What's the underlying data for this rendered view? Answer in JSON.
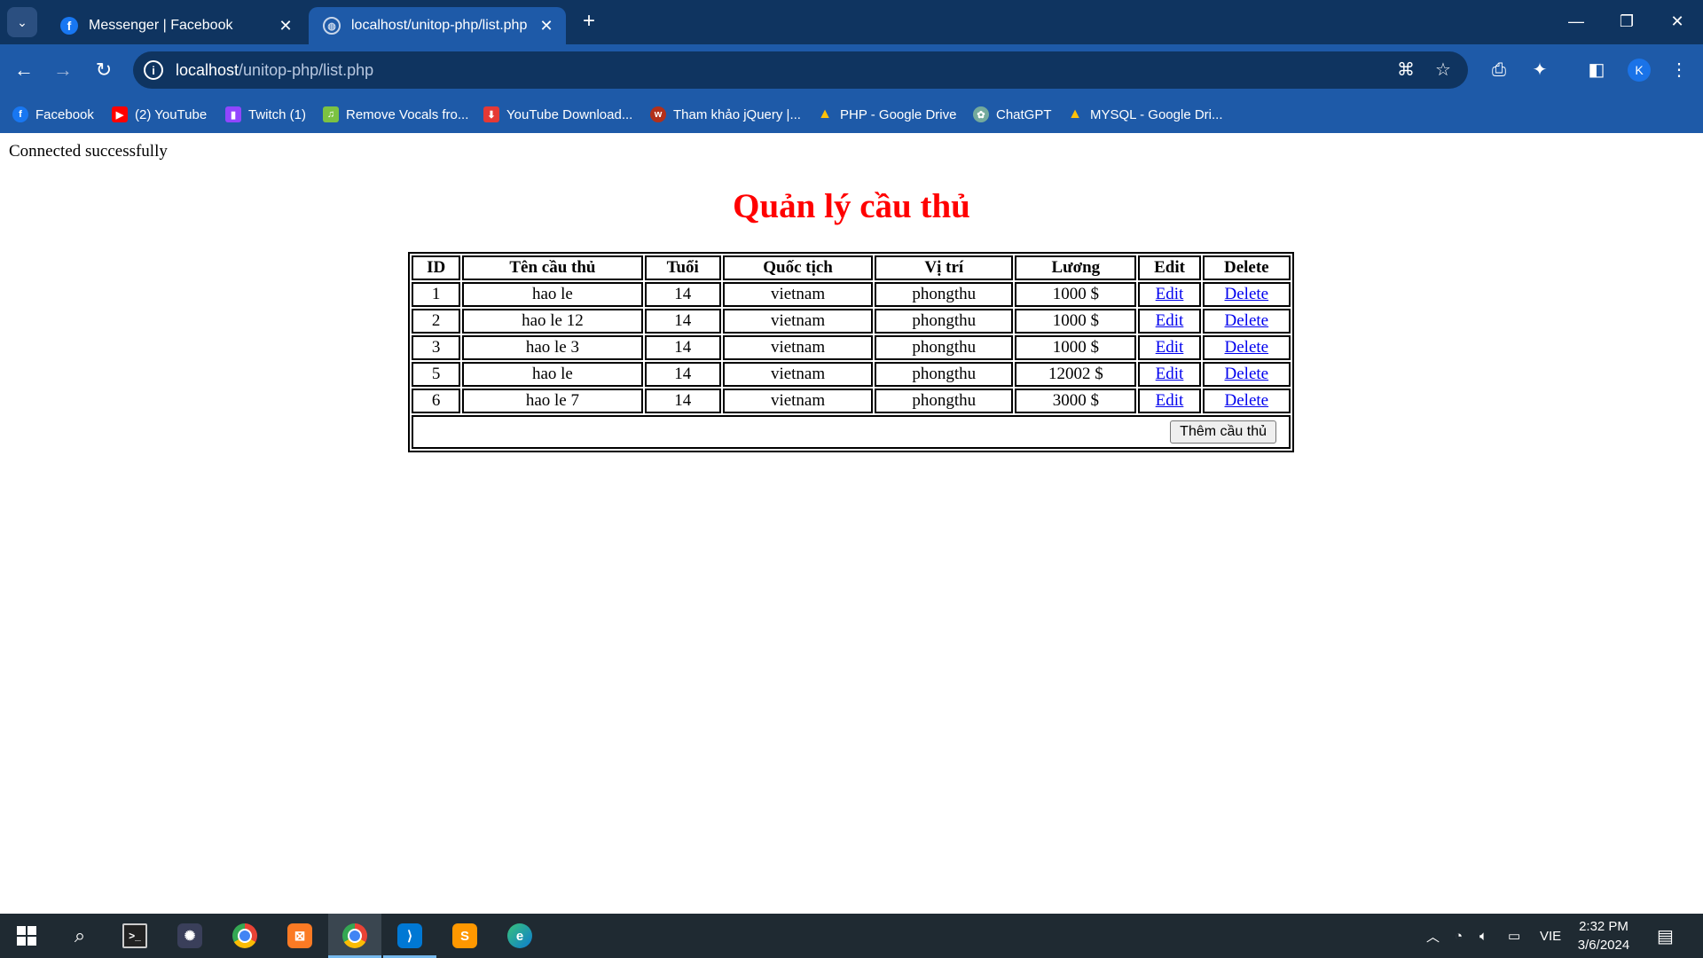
{
  "browser": {
    "tabs": [
      {
        "title": "Messenger | Facebook",
        "icon": "facebook-icon"
      },
      {
        "title": "localhost/unitop-php/list.php",
        "icon": "globe-icon",
        "active": true
      }
    ],
    "address": {
      "host": "localhost",
      "path": "/unitop-php/list.php"
    },
    "profile_initial": "K",
    "bookmarks": [
      {
        "label": "Facebook",
        "icon": "facebook-icon",
        "color": "#1877f2"
      },
      {
        "label": "(2) YouTube",
        "icon": "youtube-icon",
        "color": "#ff0000"
      },
      {
        "label": "Twitch (1)",
        "icon": "twitch-icon",
        "color": "#9146ff"
      },
      {
        "label": "Remove Vocals fro...",
        "icon": "music-icon",
        "color": "#7cc242"
      },
      {
        "label": "YouTube Download...",
        "icon": "download-icon",
        "color": "#e53935"
      },
      {
        "label": "Tham khảo jQuery |...",
        "icon": "w3schools-icon",
        "color": "#b2301a"
      },
      {
        "label": "PHP - Google Drive",
        "icon": "google-drive-icon",
        "color": "#1fa463"
      },
      {
        "label": "ChatGPT",
        "icon": "chatgpt-icon",
        "color": "#74aa9c"
      },
      {
        "label": "MYSQL - Google Dri...",
        "icon": "google-drive-icon",
        "color": "#1fa463"
      }
    ]
  },
  "page": {
    "status": "Connected successfully",
    "heading": "Quản lý cầu thủ",
    "heading_color": "#ff0000",
    "table": {
      "headers": [
        "ID",
        "Tên cầu thủ",
        "Tuổi",
        "Quốc tịch",
        "Vị trí",
        "Lương",
        "Edit",
        "Delete"
      ],
      "rows": [
        {
          "id": "1",
          "name": "hao le",
          "age": "14",
          "nationality": "vietnam",
          "position": "phongthu",
          "salary": "1000 $",
          "edit": "Edit",
          "delete": "Delete"
        },
        {
          "id": "2",
          "name": "hao le 12",
          "age": "14",
          "nationality": "vietnam",
          "position": "phongthu",
          "salary": "1000 $",
          "edit": "Edit",
          "delete": "Delete"
        },
        {
          "id": "3",
          "name": "hao le 3",
          "age": "14",
          "nationality": "vietnam",
          "position": "phongthu",
          "salary": "1000 $",
          "edit": "Edit",
          "delete": "Delete"
        },
        {
          "id": "5",
          "name": "hao le",
          "age": "14",
          "nationality": "vietnam",
          "position": "phongthu",
          "salary": "12002 $",
          "edit": "Edit",
          "delete": "Delete"
        },
        {
          "id": "6",
          "name": "hao le 7",
          "age": "14",
          "nationality": "vietnam",
          "position": "phongthu",
          "salary": "3000 $",
          "edit": "Edit",
          "delete": "Delete"
        }
      ],
      "add_button": "Thêm cầu thủ"
    }
  },
  "taskbar": {
    "apps": [
      "start-icon",
      "search-icon",
      "terminal-icon",
      "davinci-icon",
      "chrome-icon",
      "xampp-icon",
      "chrome-profile-icon",
      "vscode-icon",
      "sublime-icon",
      "edge-icon"
    ],
    "language": "VIE",
    "time": "2:32 PM",
    "date": "3/6/2024"
  }
}
